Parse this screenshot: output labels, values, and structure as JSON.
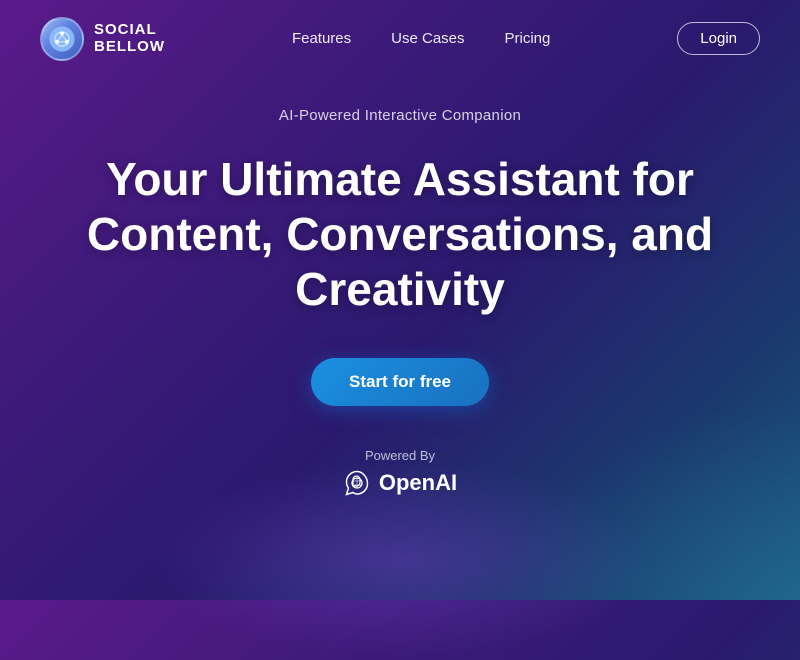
{
  "nav": {
    "logo_line1": "SOCIAL",
    "logo_line2": "BELLOW",
    "links": [
      {
        "label": "Features",
        "id": "features"
      },
      {
        "label": "Use Cases",
        "id": "use-cases"
      },
      {
        "label": "Pricing",
        "id": "pricing"
      }
    ],
    "login_label": "Login"
  },
  "hero": {
    "subtitle": "AI-Powered Interactive Companion",
    "headline": "Your Ultimate Assistant for Content, Conversations, and Creativity",
    "cta_label": "Start for free",
    "powered_label": "Powered By",
    "openai_label": "OpenAI"
  }
}
